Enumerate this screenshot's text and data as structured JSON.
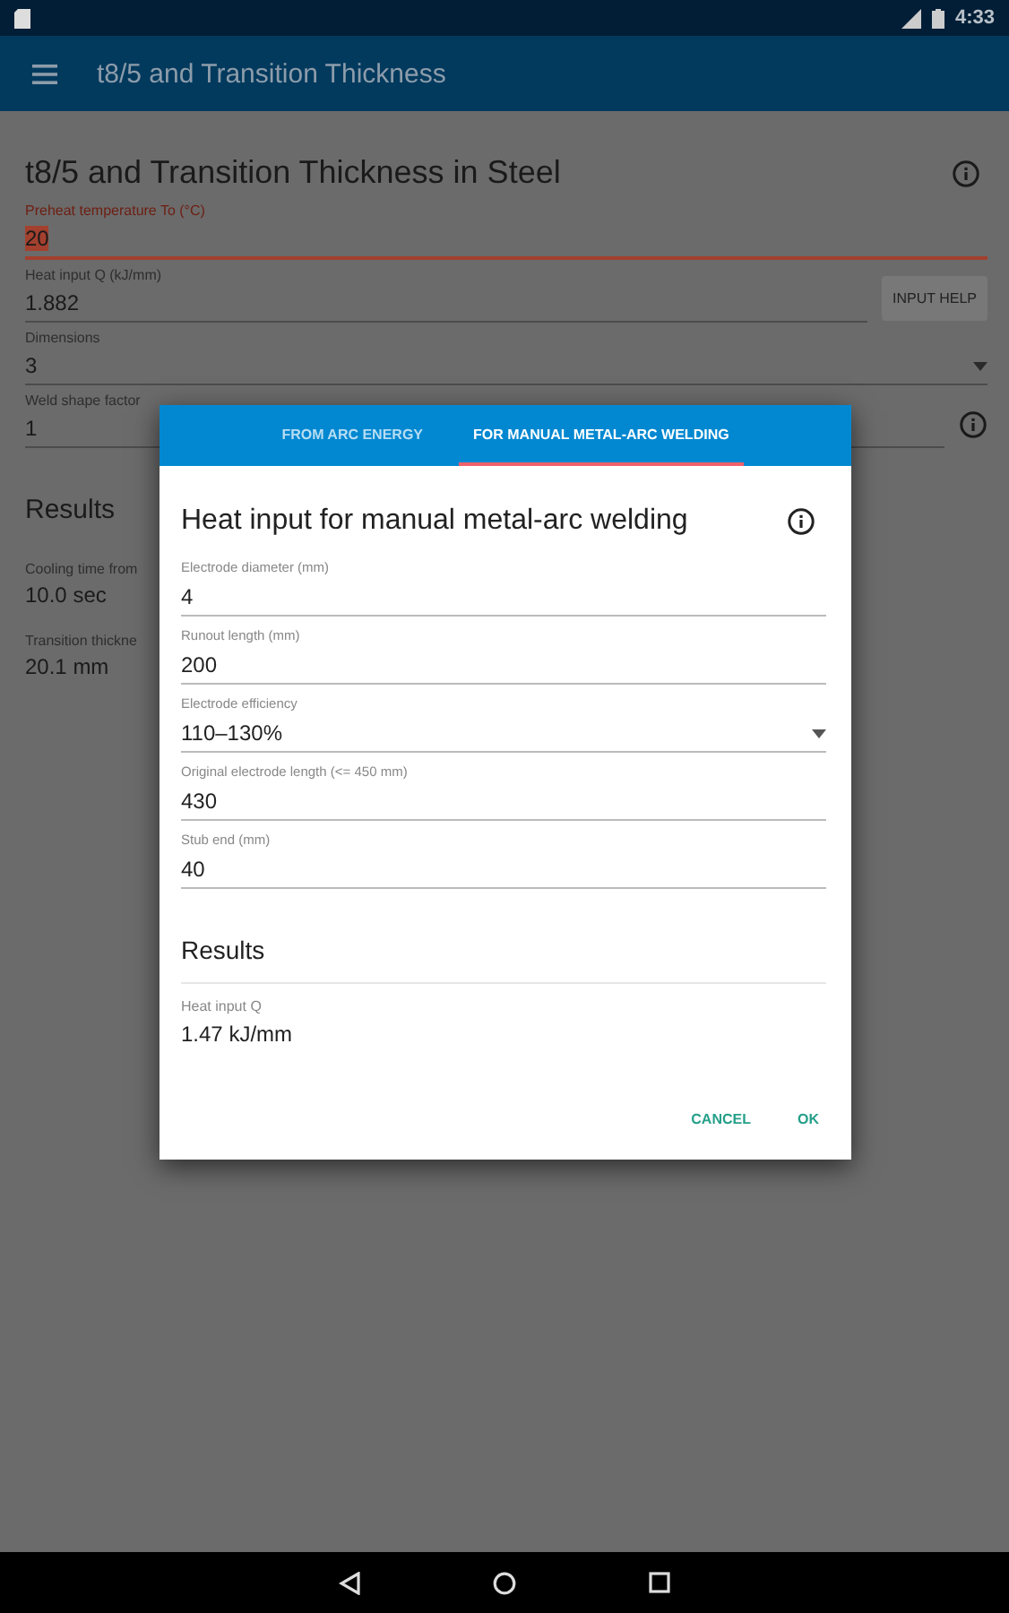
{
  "status_bar": {
    "time": "4:33"
  },
  "app_bar": {
    "title": "t8/5 and Transition Thickness"
  },
  "page": {
    "title": "t8/5 and Transition Thickness in Steel",
    "fields": [
      {
        "kind": "text",
        "label": "Preheat temperature To (°C)",
        "value": "20",
        "focused": true
      },
      {
        "kind": "text",
        "label": "Heat input Q (kJ/mm)",
        "value": "1.882",
        "focused": false,
        "button": "INPUT HELP"
      },
      {
        "kind": "dropdown",
        "label": "Dimensions",
        "value": "3",
        "focused": false
      },
      {
        "kind": "text",
        "label": "Weld shape factor",
        "value": "1",
        "focused": false,
        "info": true
      }
    ],
    "results_title": "Results",
    "results": [
      {
        "label": "Cooling time from",
        "value": "10.0 sec"
      },
      {
        "label": "Transition thickne",
        "value": "20.1 mm"
      }
    ]
  },
  "dialog": {
    "tabs": [
      {
        "label": "FROM ARC ENERGY",
        "selected": false
      },
      {
        "label": "FOR MANUAL METAL-ARC WELDING",
        "selected": true
      }
    ],
    "title": "Heat input for manual metal-arc welding",
    "fields": [
      {
        "kind": "text",
        "label": "Electrode diameter (mm)",
        "value": "4"
      },
      {
        "kind": "text",
        "label": "Runout length (mm)",
        "value": "200"
      },
      {
        "kind": "dropdown",
        "label": "Electrode efficiency",
        "value": "110–130%"
      },
      {
        "kind": "text",
        "label": "Original electrode length (<= 450 mm)",
        "value": "430"
      },
      {
        "kind": "text",
        "label": "Stub end (mm)",
        "value": "40"
      }
    ],
    "results_title": "Results",
    "results": [
      {
        "label": "Heat input Q",
        "value": "1.47 kJ/mm"
      }
    ],
    "buttons": [
      "CANCEL",
      "OK"
    ]
  }
}
